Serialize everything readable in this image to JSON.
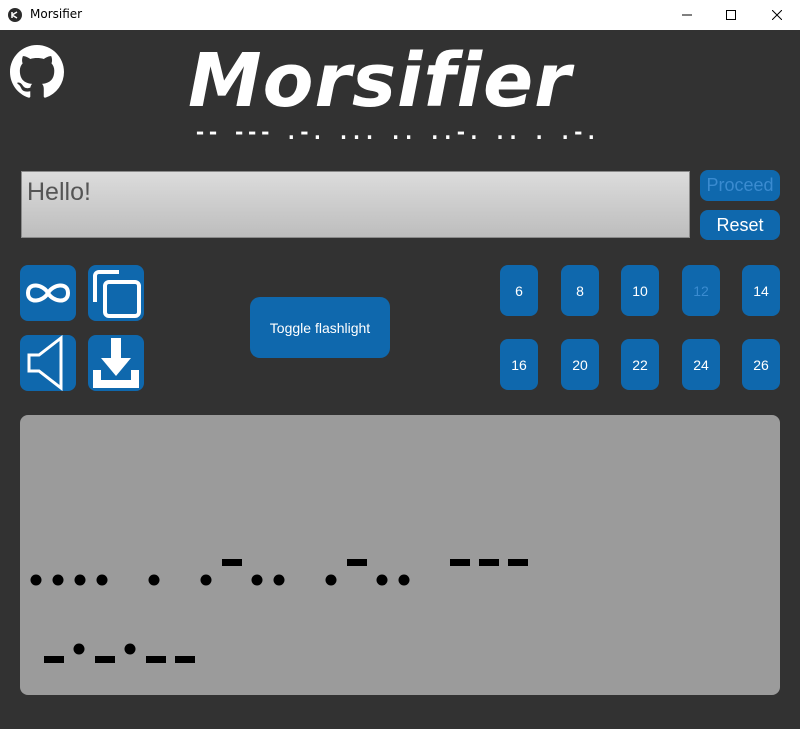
{
  "window": {
    "title": "Morsifier"
  },
  "logo": {
    "word": "Morsifier",
    "morse": "-- --- .-. ... .. ..-. .. . .-."
  },
  "input": {
    "value": "Hello!"
  },
  "buttons": {
    "proceed": "Proceed",
    "reset": "Reset",
    "flashlight": "Toggle flashlight"
  },
  "icons": {
    "github": "github-icon",
    "loop": "infinity-icon",
    "copy": "copy-icon",
    "sound": "speaker-icon",
    "download": "download-icon"
  },
  "speeds": [
    {
      "label": "6",
      "active": false
    },
    {
      "label": "8",
      "active": false
    },
    {
      "label": "10",
      "active": false
    },
    {
      "label": "12",
      "active": true
    },
    {
      "label": "14",
      "active": false
    },
    {
      "label": "16",
      "active": false
    },
    {
      "label": "20",
      "active": false
    },
    {
      "label": "22",
      "active": false
    },
    {
      "label": "24",
      "active": false
    },
    {
      "label": "26",
      "active": false
    }
  ],
  "output": {
    "words": [
      ".... . .-.. .-.. ---",
      "-.-.--"
    ]
  },
  "colors": {
    "background": "#323232",
    "accent": "#0f68ad",
    "accent_dim_text": "#3a8bd0",
    "output_bg": "#9b9b9b"
  }
}
